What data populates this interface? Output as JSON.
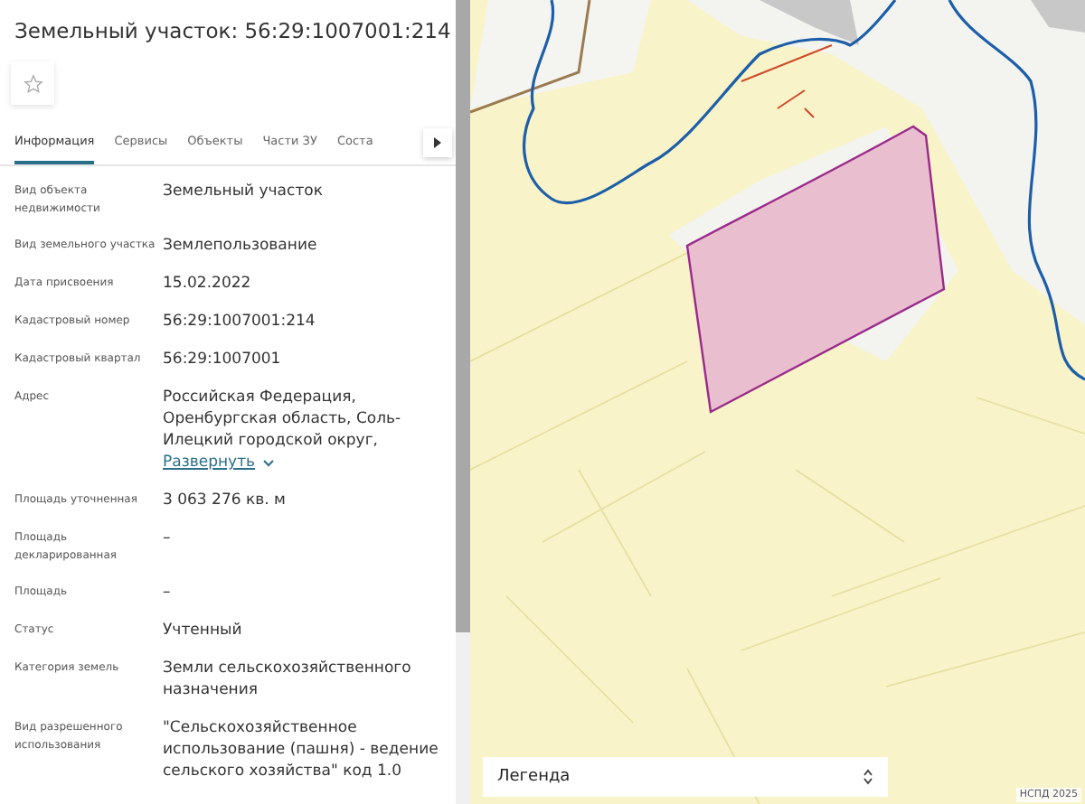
{
  "panel": {
    "title": "Земельный участок: 56:29:1007001:214",
    "favorite": false,
    "tabs": [
      {
        "label": "Информация",
        "selected": true
      },
      {
        "label": "Сервисы",
        "selected": false
      },
      {
        "label": "Объекты",
        "selected": false
      },
      {
        "label": "Части ЗУ",
        "selected": false
      },
      {
        "label": "Соста",
        "selected": false
      }
    ],
    "fields": [
      {
        "label": "Вид объекта недвижимости",
        "value": "Земельный участок"
      },
      {
        "label": "Вид земельного участка",
        "value": "Землепользование"
      },
      {
        "label": "Дата присвоения",
        "value": "15.02.2022"
      },
      {
        "label": "Кадастровый номер",
        "value": "56:29:1007001:214"
      },
      {
        "label": "Кадастровый квартал",
        "value": "56:29:1007001"
      },
      {
        "label": "Адрес",
        "value": "Российская Федерация, Оренбургская область, Соль-Илецкий городской округ,",
        "link": "Развернуть"
      },
      {
        "label": "Площадь уточненная",
        "value": "3 063 276 кв. м"
      },
      {
        "label": "Площадь декларированная",
        "value": "–"
      },
      {
        "label": "Площадь",
        "value": "–"
      },
      {
        "label": "Статус",
        "value": "Учтенный"
      },
      {
        "label": "Категория земель",
        "value": "Земли сельскохозяйственного назначения"
      },
      {
        "label": "Вид разрешенного использования",
        "value": "\"Сельскохозяйственное использование (пашня) - ведение сельского хозяйства\" код 1.0"
      }
    ]
  },
  "map": {
    "legend": "Легенда",
    "credit": "НСПД 2025"
  }
}
